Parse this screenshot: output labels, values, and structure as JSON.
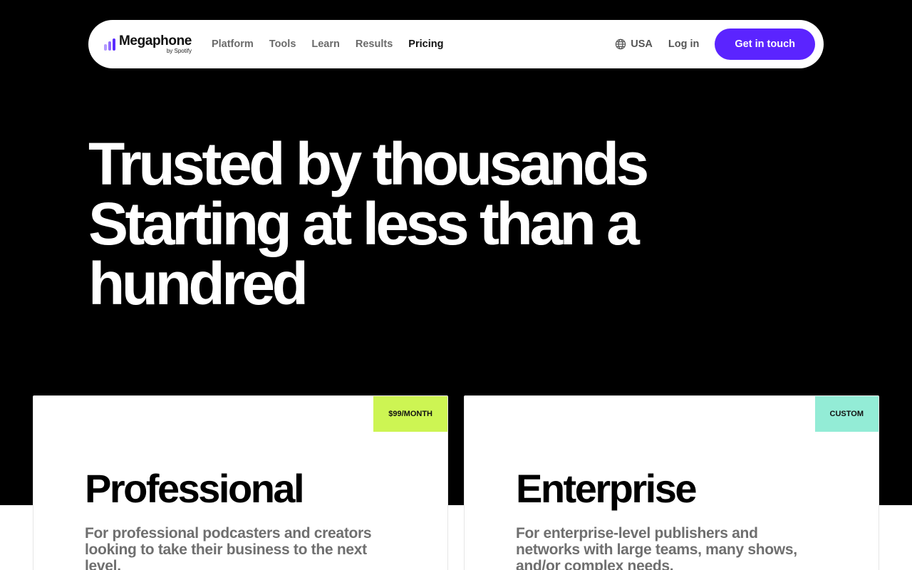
{
  "brand": {
    "name": "Megaphone",
    "sub": "by Spotify",
    "color": "#5b24ff"
  },
  "nav": {
    "links": [
      {
        "label": "Platform"
      },
      {
        "label": "Tools"
      },
      {
        "label": "Learn"
      },
      {
        "label": "Results"
      },
      {
        "label": "Pricing",
        "active": true
      }
    ],
    "locale": "USA",
    "login": "Log in",
    "cta": "Get in touch"
  },
  "hero": {
    "lines": [
      "Trusted by thousands",
      "Starting at less than a",
      "hundred"
    ]
  },
  "plans": [
    {
      "name": "Professional",
      "price_tag": "$99/MONTH",
      "tag_color": "#cdf553",
      "description": "For professional podcasters and creators looking to take their business to the next level."
    },
    {
      "name": "Enterprise",
      "price_tag": "CUSTOM",
      "tag_color": "#93ecd6",
      "description": "For enterprise-level publishers and networks with large teams, many shows, and/or complex needs."
    }
  ],
  "icons": {
    "locale": "globe-icon",
    "logo": "megaphone-logo-icon"
  }
}
